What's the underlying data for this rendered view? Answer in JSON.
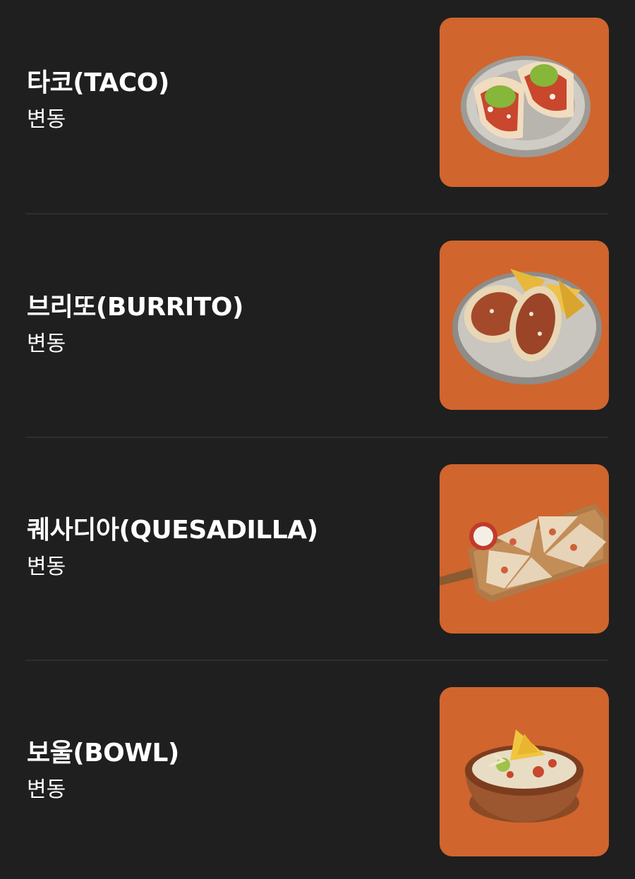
{
  "colors": {
    "background": "#1f1f1f",
    "card": "#d0652e",
    "text": "#ffffff",
    "divider": "#2e2e2e"
  },
  "menu": {
    "items": [
      {
        "name": "타코(TACO)",
        "price": "변동",
        "image_icon": "taco-plate-icon"
      },
      {
        "name": "브리또(BURRITO)",
        "price": "변동",
        "image_icon": "burrito-plate-icon"
      },
      {
        "name": "퀘사디아(QUESADILLA)",
        "price": "변동",
        "image_icon": "quesadilla-board-icon"
      },
      {
        "name": "보울(BOWL)",
        "price": "변동",
        "image_icon": "bowl-icon"
      }
    ]
  }
}
